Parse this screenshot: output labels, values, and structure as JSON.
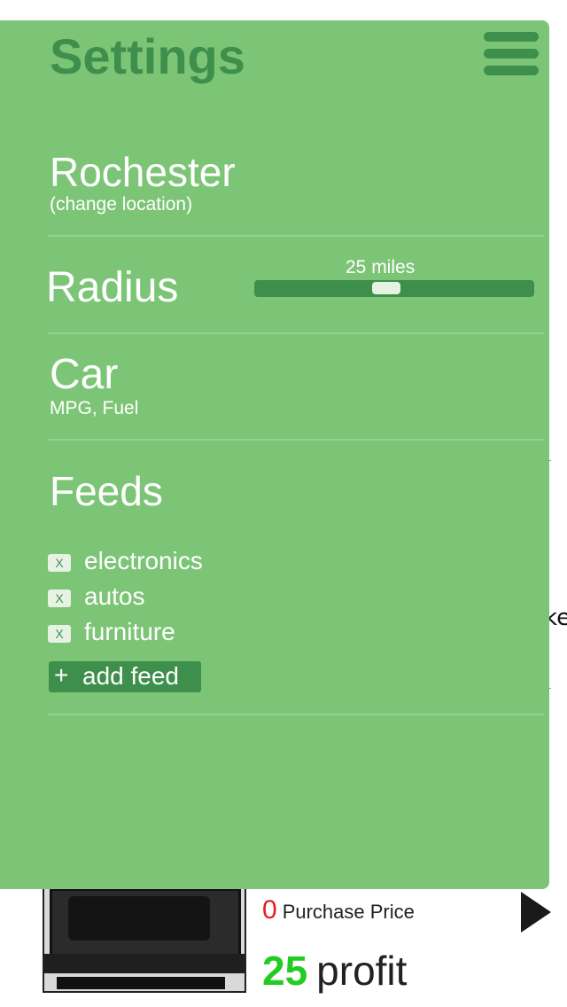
{
  "settings": {
    "title": "Settings",
    "location": {
      "name": "Rochester",
      "change_label": "(change location)"
    },
    "radius": {
      "label": "Radius",
      "value_label": "25 miles",
      "slider_fraction": 0.47
    },
    "car": {
      "label": "Car",
      "sub_label": "MPG, Fuel"
    },
    "feeds": {
      "label": "Feeds",
      "items": [
        {
          "remove_label": "X",
          "name": "electronics"
        },
        {
          "remove_label": "X",
          "name": "autos"
        },
        {
          "remove_label": "X",
          "name": "furniture"
        }
      ],
      "add_plus": "+",
      "add_label": "add feed"
    }
  },
  "listing": {
    "purchase_price_value": "0",
    "purchase_price_label": "Purchase Price",
    "profit_value": "25",
    "profit_label": "profit",
    "edge_fragment": "ke"
  },
  "colors": {
    "panel_bg": "#7dc576",
    "accent_dark_green": "#3f8f4c",
    "price_red": "#e02020",
    "profit_green": "#22cc22"
  },
  "icons": {
    "menu": "hamburger-menu-icon",
    "play": "play-triangle-icon"
  }
}
